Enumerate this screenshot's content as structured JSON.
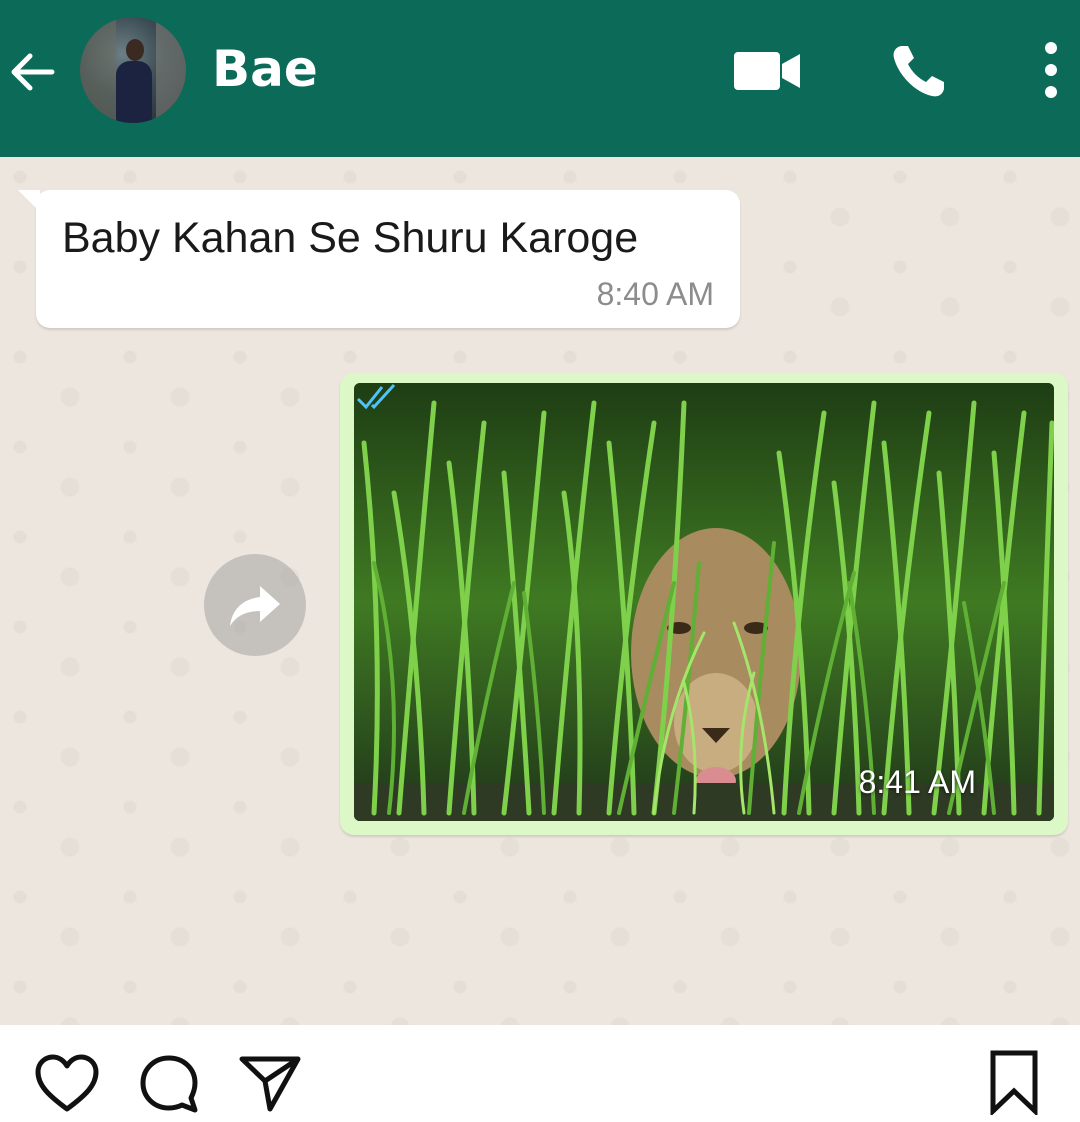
{
  "header": {
    "contact_name": "Bae",
    "background_color": "#0b6a58",
    "icons": [
      "back-arrow-icon",
      "video-call-icon",
      "phone-call-icon",
      "more-options-icon"
    ]
  },
  "messages": [
    {
      "direction": "incoming",
      "text": "Baby Kahan Se Shuru Karoge",
      "time": "8:40 AM"
    },
    {
      "direction": "outgoing",
      "type": "image",
      "time": "8:41 AM",
      "status": "read"
    }
  ],
  "chat": {
    "background_color": "#ece6de",
    "incoming_bubble_color": "#ffffff",
    "outgoing_bubble_color": "#dcf8c6"
  },
  "instagram_actions": {
    "icons": [
      "heart-icon",
      "comment-icon",
      "share-icon",
      "bookmark-icon"
    ]
  }
}
